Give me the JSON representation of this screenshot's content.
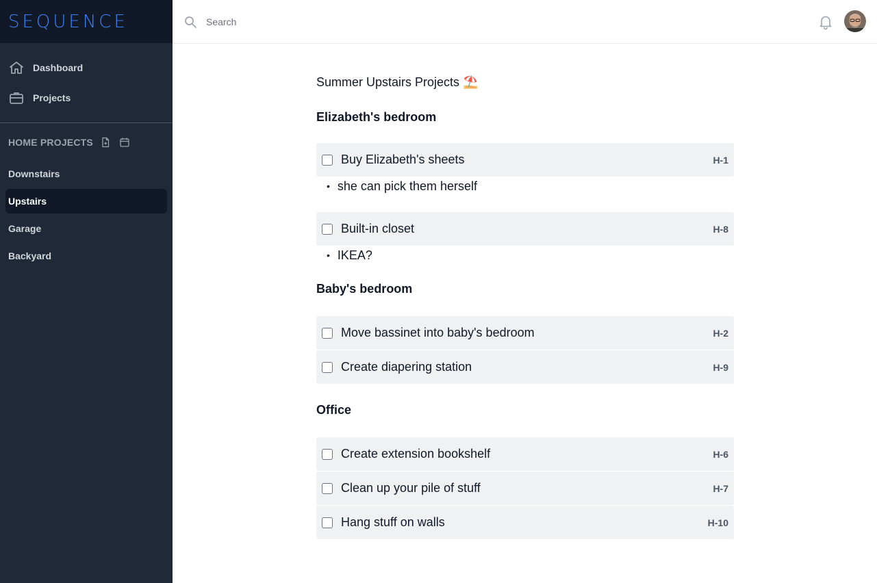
{
  "brand": "SEQUENCE",
  "colors": {
    "sidebar": "#1f2937",
    "brand_bar": "#111827",
    "accent": "#3b82f6",
    "task_bg": "#f0f1f3"
  },
  "nav": [
    {
      "label": "Dashboard",
      "icon": "home-icon"
    },
    {
      "label": "Projects",
      "icon": "briefcase-icon"
    }
  ],
  "section": {
    "title": "HOME PROJECTS",
    "icons": [
      "new-document-icon",
      "calendar-icon"
    ]
  },
  "projects": [
    {
      "label": "Downstairs",
      "active": false
    },
    {
      "label": "Upstairs",
      "active": true
    },
    {
      "label": "Garage",
      "active": false
    },
    {
      "label": "Backyard",
      "active": false
    }
  ],
  "search": {
    "placeholder": "Search",
    "value": ""
  },
  "page": {
    "title": "Summer Upstairs Projects ⛱️",
    "groups": [
      {
        "title": "Elizabeth's bedroom",
        "tasks": [
          {
            "label": "Buy Elizabeth's sheets",
            "code": "H-1",
            "note": "she can pick them herself"
          },
          {
            "label": "Built-in closet",
            "code": "H-8",
            "note": "IKEA?"
          }
        ]
      },
      {
        "title": "Baby's bedroom",
        "tasks": [
          {
            "label": "Move bassinet into baby's bedroom",
            "code": "H-2"
          },
          {
            "label": "Create diapering station",
            "code": "H-9"
          }
        ]
      },
      {
        "title": "Office",
        "tasks": [
          {
            "label": "Create extension bookshelf",
            "code": "H-6"
          },
          {
            "label": "Clean up your pile of stuff",
            "code": "H-7"
          },
          {
            "label": "Hang stuff on walls",
            "code": "H-10"
          }
        ]
      }
    ]
  }
}
